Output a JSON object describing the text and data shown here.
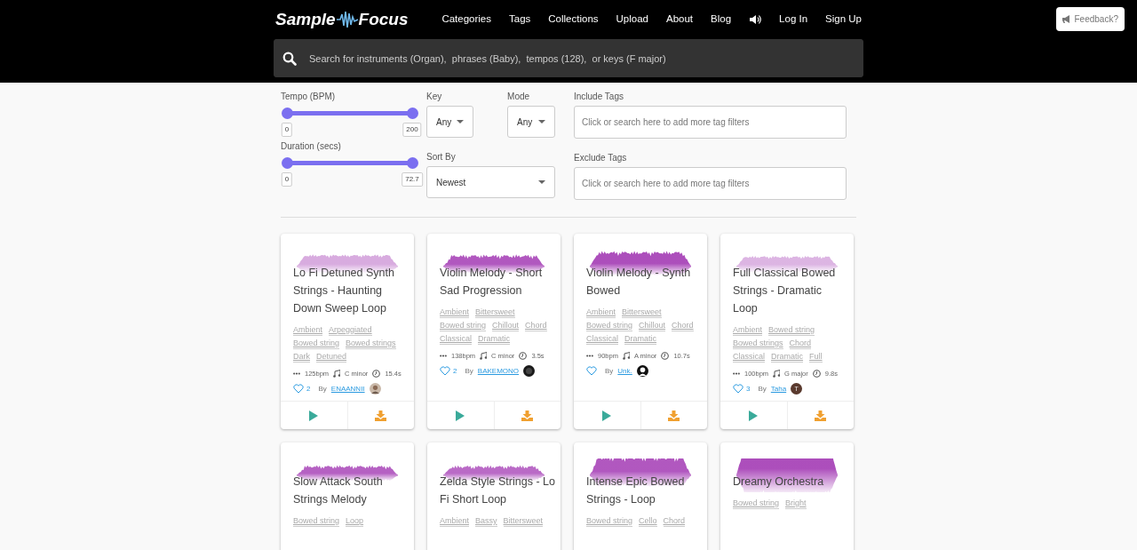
{
  "brand": {
    "name_left": "Sample",
    "name_right": "Focus"
  },
  "nav": [
    {
      "label": "Categories",
      "kind": "link"
    },
    {
      "label": "Tags",
      "kind": "link"
    },
    {
      "label": "Collections",
      "kind": "link"
    },
    {
      "label": "Upload",
      "kind": "link"
    },
    {
      "label": "About",
      "kind": "link"
    },
    {
      "label": "Blog",
      "kind": "link"
    },
    {
      "kind": "sound"
    },
    {
      "label": "Log In",
      "kind": "link"
    },
    {
      "label": "Sign Up",
      "kind": "link"
    }
  ],
  "feedback": {
    "label": "Feedback?"
  },
  "search": {
    "placeholder": "Search for instruments (Organ),  phrases (Baby),  tempos (128),  or keys (F major)"
  },
  "filters": {
    "tempo": {
      "label": "Tempo (BPM)",
      "thumbs": [
        {
          "level": 0,
          "reading": "0"
        },
        {
          "level": 1,
          "reading": "200"
        }
      ]
    },
    "key": {
      "label": "Key",
      "value": "Any"
    },
    "mode": {
      "label": "Mode",
      "value": "Any"
    },
    "include_tags": {
      "label": "Include Tags",
      "placeholder": "Click or search here to add more tag filters"
    },
    "duration": {
      "label": "Duration (secs)",
      "thumbs": [
        {
          "level": 0,
          "reading": "0"
        },
        {
          "level": 1,
          "reading": "72.7"
        }
      ]
    },
    "sort_by": {
      "label": "Sort By",
      "value": "Newest"
    },
    "exclude_tags": {
      "label": "Exclude Tags",
      "placeholder": "Click or search here to add more tag filters"
    }
  },
  "samples": [
    {
      "title": "Lo Fi Detuned Synth Strings - Haunting Down Sweep Loop",
      "tags": [
        "Ambient",
        "Arpeggiated",
        "Bowed string",
        "Bowed strings",
        "Dark",
        "Detuned"
      ],
      "bpm": "125bpm",
      "key": "C minor",
      "duration": "15.4s",
      "likes": "2",
      "by_label": "By",
      "author": "ENAANNII",
      "avatar": {
        "kind": "photo"
      }
    },
    {
      "title": "Violin Melody - Short Sad Progression",
      "tags": [
        "Ambient",
        "Bittersweet",
        "Bowed string",
        "Chillout",
        "Chord",
        "Classical",
        "Dramatic"
      ],
      "bpm": "138bpm",
      "key": "C minor",
      "duration": "3.5s",
      "likes": "2",
      "by_label": "By",
      "author": "BAKEMONO",
      "avatar": {
        "kind": "dark"
      }
    },
    {
      "title": "Violin Melody - Synth Bowed",
      "tags": [
        "Ambient",
        "Bittersweet",
        "Bowed string",
        "Chillout",
        "Chord",
        "Classical",
        "Dramatic"
      ],
      "bpm": "90bpm",
      "key": "A minor",
      "duration": "10.7s",
      "by_label": "By",
      "author": "Unk.",
      "avatar": {
        "kind": "silhouette"
      }
    },
    {
      "title": "Full Classical Bowed Strings - Dramatic Loop",
      "tags": [
        "Ambient",
        "Bowed string",
        "Bowed strings",
        "Chord",
        "Classical",
        "Dramatic",
        "Full"
      ],
      "bpm": "100bpm",
      "key": "G major",
      "duration": "9.8s",
      "likes": "3",
      "by_label": "By",
      "author": "Taha",
      "avatar": {
        "kind": "initial",
        "initial": "T"
      }
    },
    {
      "title": "Slow Attack South Strings Melody",
      "tags": [
        "Bowed string",
        "Loop"
      ]
    },
    {
      "title": "Zelda Style Strings - Lo Fi Short Loop",
      "tags": [
        "Ambient",
        "Bassy",
        "Bittersweet"
      ]
    },
    {
      "title": "Intense Epic Bowed Strings - Loop",
      "tags": [
        "Bowed string",
        "Cello",
        "Chord"
      ]
    },
    {
      "title": "Dreamy Orchestra",
      "tags": [
        "Bowed string",
        "Bright"
      ]
    }
  ]
}
